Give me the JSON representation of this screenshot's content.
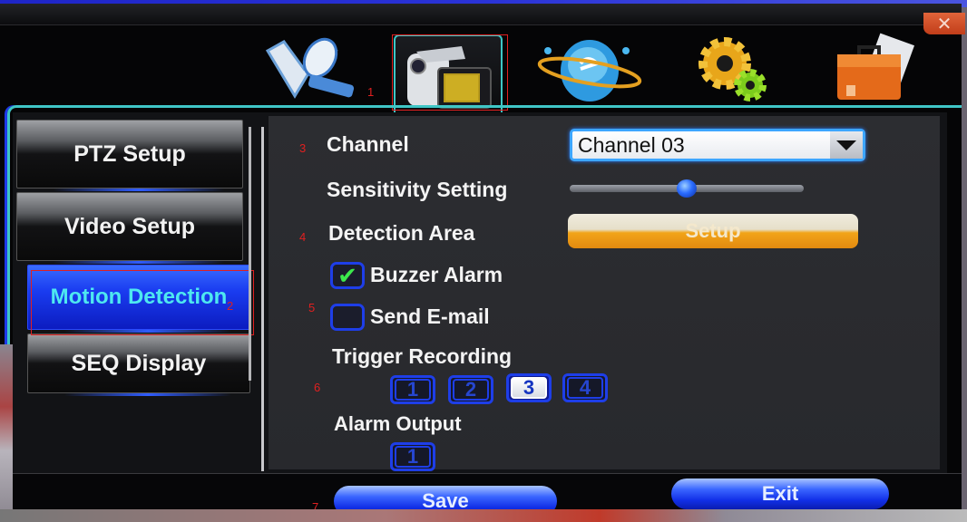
{
  "window": {
    "close_label": "✕"
  },
  "top_tabs": [
    {
      "name": "record-playback",
      "icon": "film-reel-icon",
      "active": false
    },
    {
      "name": "camera-setup",
      "icon": "camcorder-icon",
      "active": true
    },
    {
      "name": "network",
      "icon": "globe-network-icon",
      "active": false
    },
    {
      "name": "system-settings",
      "icon": "gears-icon",
      "active": false
    },
    {
      "name": "information",
      "icon": "briefcase-icon",
      "active": false
    }
  ],
  "sidebar": {
    "items": [
      {
        "label": "PTZ Setup",
        "active": false
      },
      {
        "label": "Video Setup",
        "active": false
      },
      {
        "label": "Motion Detection",
        "active": true
      },
      {
        "label": "SEQ Display",
        "active": false
      }
    ]
  },
  "annotations": [
    "1",
    "2",
    "3",
    "4",
    "5",
    "6",
    "7"
  ],
  "form": {
    "channel": {
      "label": "Channel",
      "value": "Channel 03"
    },
    "sensitivity": {
      "label": "Sensitivity Setting",
      "value_fraction": 0.5
    },
    "detection_area": {
      "label": "Detection Area",
      "button": "Setup"
    },
    "buzzer_alarm": {
      "label": "Buzzer Alarm",
      "checked": true
    },
    "send_email": {
      "label": "Send E-mail",
      "checked": false
    },
    "trigger_recording": {
      "label": "Trigger Recording",
      "channels": [
        {
          "label": "1",
          "selected": false
        },
        {
          "label": "2",
          "selected": false
        },
        {
          "label": "3",
          "selected": true
        },
        {
          "label": "4",
          "selected": false
        }
      ]
    },
    "alarm_output": {
      "label": "Alarm Output",
      "channels": [
        {
          "label": "1",
          "selected": false
        }
      ]
    }
  },
  "footer": {
    "save_label": "Save",
    "exit_label": "Exit"
  }
}
